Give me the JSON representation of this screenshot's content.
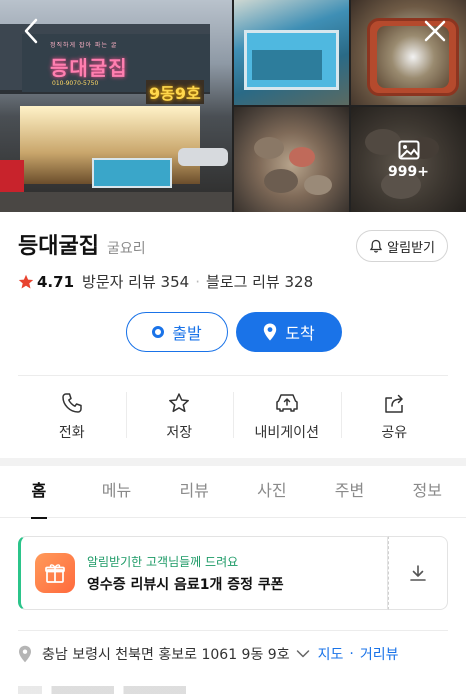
{
  "photos": {
    "storefront": {
      "sign_small": "정직하게 잡아 파는 굴",
      "sign_name": "등대굴집",
      "sign_sub": "010-9070-5750",
      "sign_ho": "9동9호"
    },
    "more_count": "999+"
  },
  "place": {
    "name": "등대굴집",
    "category": "굴요리",
    "notify_label": "알림받기",
    "rating": "4.71",
    "visitor_reviews": "방문자 리뷰 354",
    "blog_reviews": "블로그 리뷰 328"
  },
  "route": {
    "depart_label": "출발",
    "arrive_label": "도착"
  },
  "actions": [
    {
      "label": "전화",
      "icon": "phone-icon"
    },
    {
      "label": "저장",
      "icon": "star-icon"
    },
    {
      "label": "내비게이션",
      "icon": "navigation-icon"
    },
    {
      "label": "공유",
      "icon": "share-icon"
    }
  ],
  "tabs": [
    "홈",
    "메뉴",
    "리뷰",
    "사진",
    "주변",
    "정보"
  ],
  "active_tab": "홈",
  "coupon": {
    "headline": "알림받기한 고객님들께 드려요",
    "title": "영수증 리뷰시 음료1개 증정 쿠폰"
  },
  "address": {
    "text": "충남 보령시 천북면 홍보로 1061 9동 9호",
    "map_link": "지도",
    "distance_link": "거리뷰"
  },
  "colors": {
    "accent_blue": "#1a73e8",
    "star_red": "#e8432f",
    "coupon_green": "#1c9a66"
  }
}
